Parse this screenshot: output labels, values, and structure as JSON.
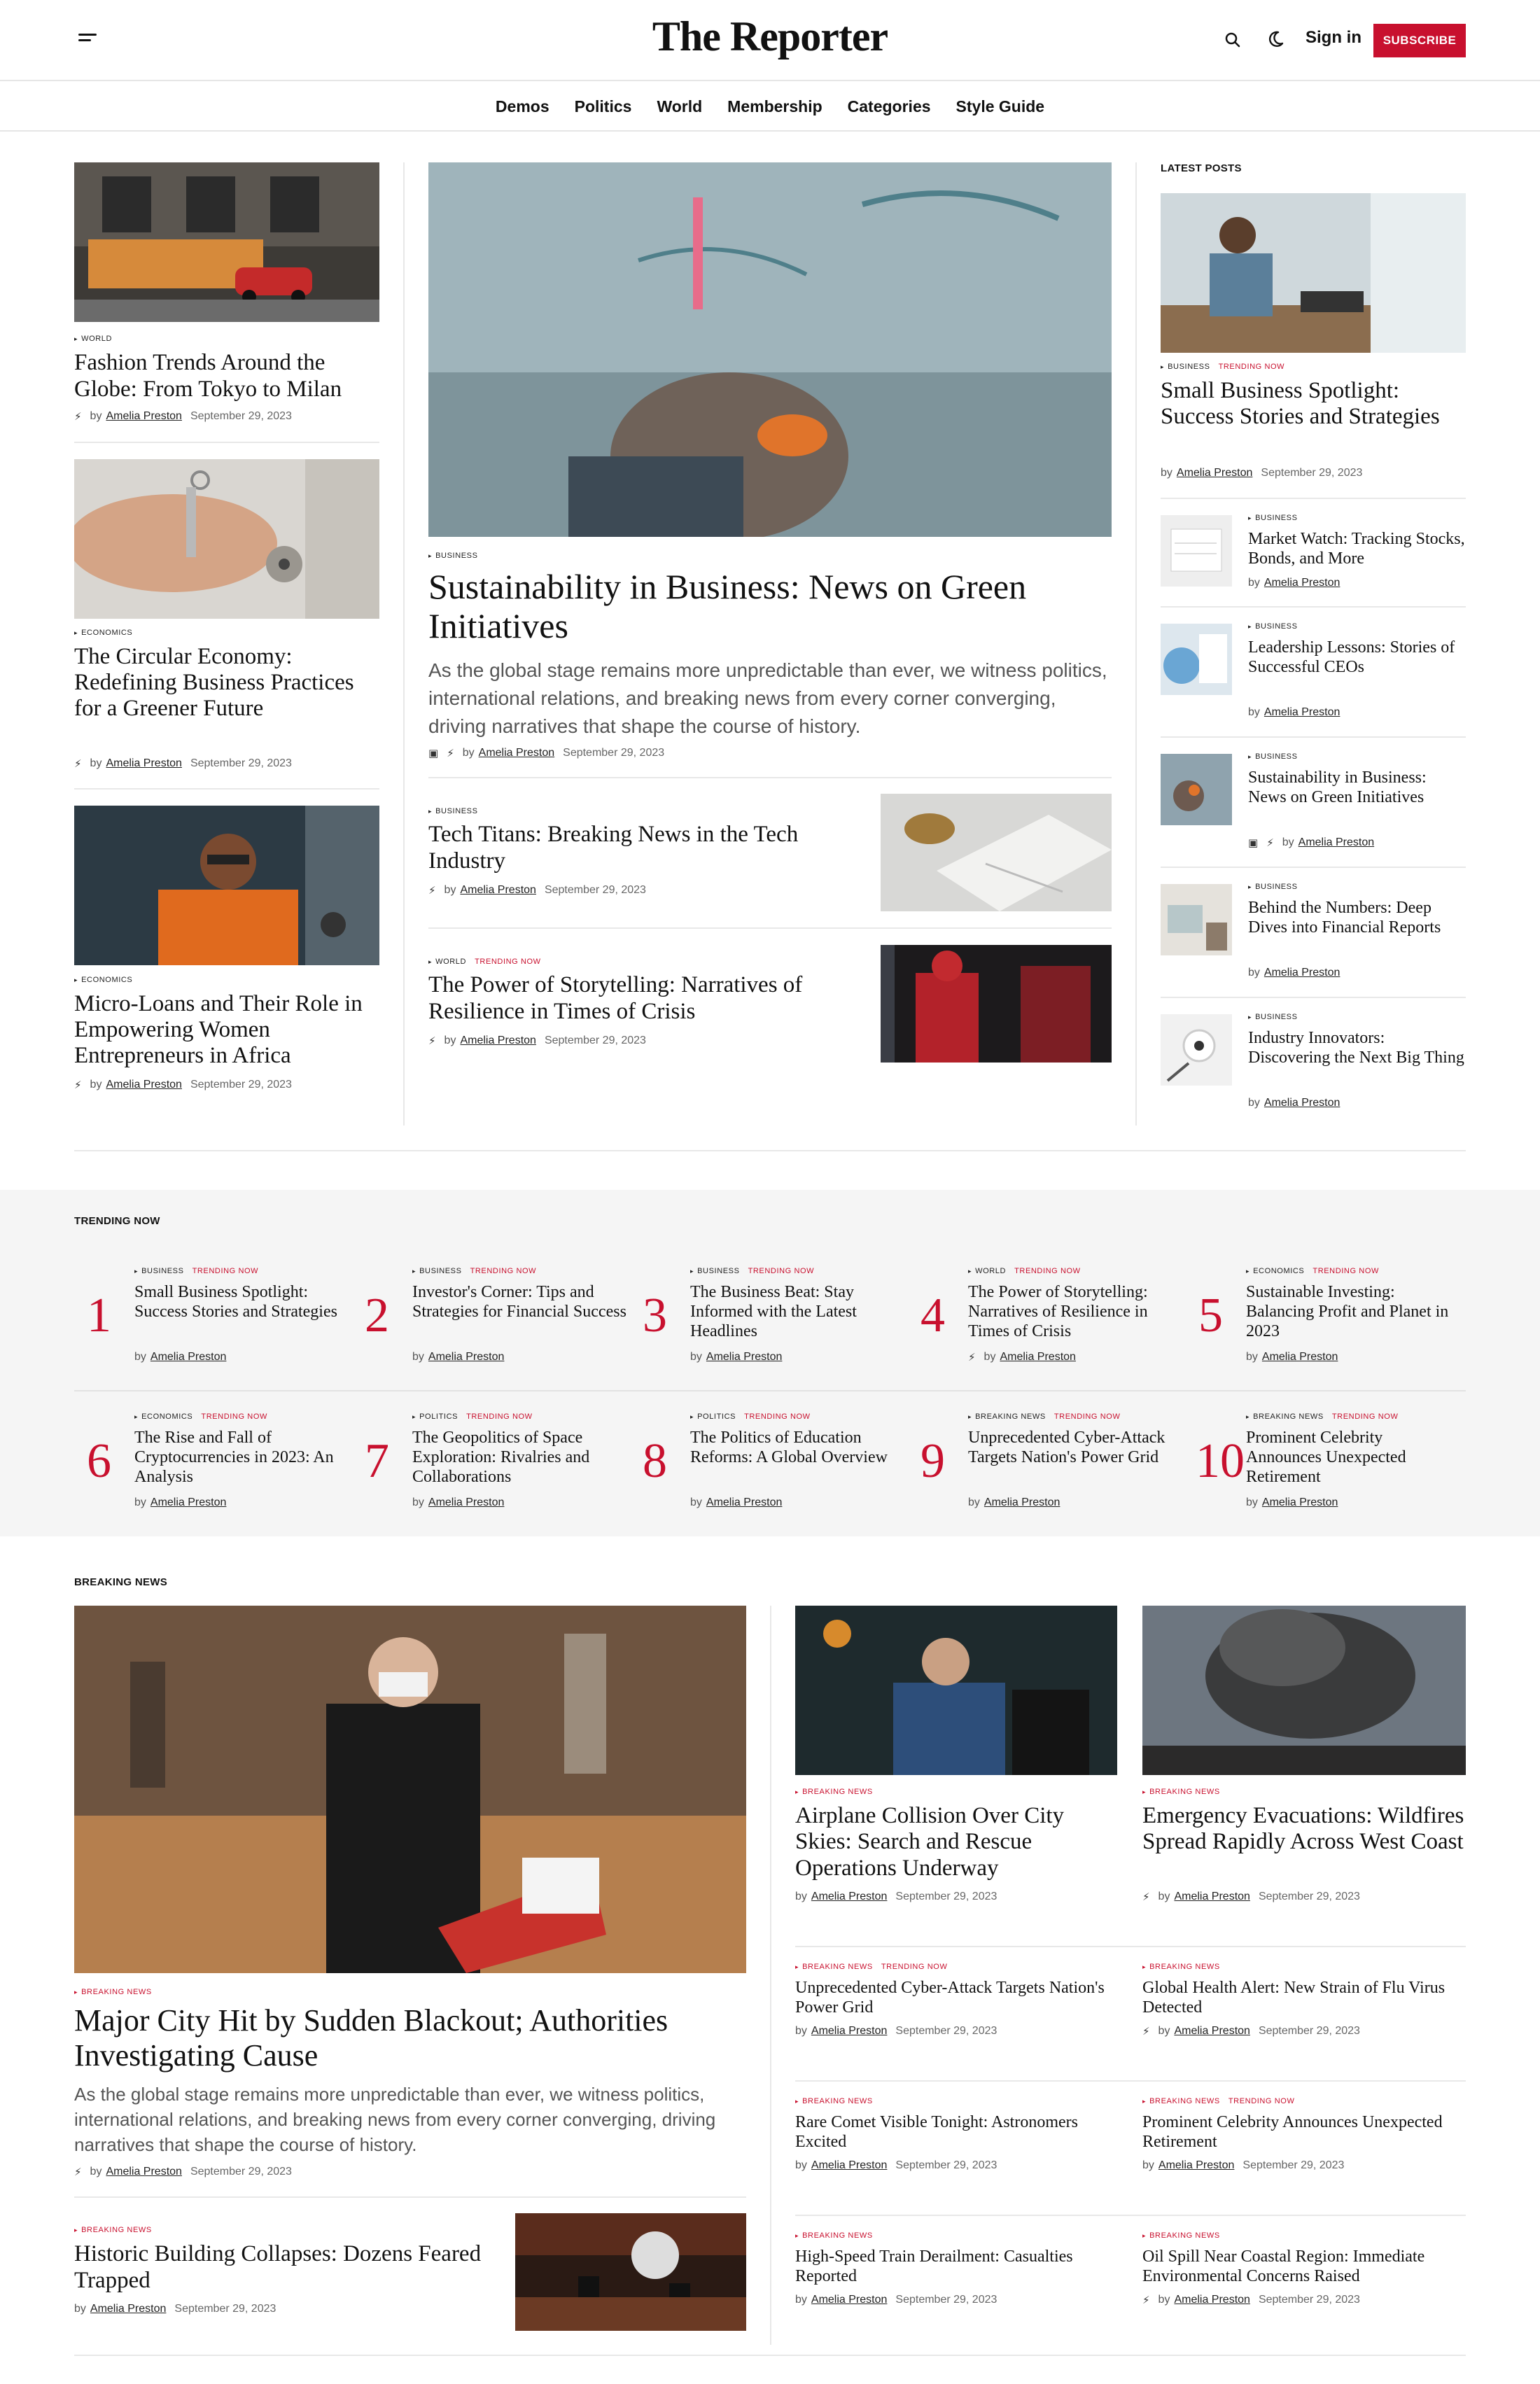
{
  "header": {
    "logo": "The Reporter",
    "sign_in": "Sign in",
    "subscribe": "SUBSCRIBE",
    "nav": [
      "Demos",
      "Politics",
      "World",
      "Membership",
      "Categories",
      "Style Guide"
    ]
  },
  "author": "Amelia Preston",
  "date": "September 29, 2023",
  "by": "by",
  "colors": {
    "accent": "#c8102e",
    "background": "#ffffff",
    "muted": "#f5f5f5"
  },
  "left": [
    {
      "cat": "WORLD",
      "title": "Fashion Trends Around the Globe: From Tokyo to Milan"
    },
    {
      "cat": "ECONOMICS",
      "title": "The Circular Economy: Redefining Business Practices for a Greener Future"
    },
    {
      "cat": "ECONOMICS",
      "title": "Micro-Loans and Their Role in Empowering Women Entrepreneurs in Africa"
    }
  ],
  "feature": {
    "cat": "BUSINESS",
    "title": "Sustainability in Business: News on Green Initiatives",
    "excerpt": "As the global stage remains more unpredictable than ever, we witness politics, international relations, and breaking news from every corner converging, driving narratives that shape the course of history."
  },
  "mid": [
    {
      "cat": "BUSINESS",
      "trend": "",
      "title": "Tech Titans: Breaking News in the Tech Industry"
    },
    {
      "cat": "WORLD",
      "trend": "TRENDING NOW",
      "title": "The Power of Storytelling: Narratives of Resilience in Times of Crisis"
    }
  ],
  "latest": {
    "label": "LATEST POSTS",
    "top": {
      "cat": "BUSINESS",
      "trend": "TRENDING NOW",
      "title": "Small Business Spotlight: Success Stories and Strategies"
    },
    "items": [
      {
        "cat": "BUSINESS",
        "title": "Market Watch: Tracking Stocks, Bonds, and More"
      },
      {
        "cat": "BUSINESS",
        "title": "Leadership Lessons: Stories of Successful CEOs"
      },
      {
        "cat": "BUSINESS",
        "title": "Sustainability in Business: News on Green Initiatives"
      },
      {
        "cat": "BUSINESS",
        "title": "Behind the Numbers: Deep Dives into Financial Reports"
      },
      {
        "cat": "BUSINESS",
        "title": "Industry Innovators: Discovering the Next Big Thing"
      }
    ]
  },
  "trending": {
    "label": "TRENDING NOW",
    "trend": "TRENDING NOW",
    "items": [
      {
        "n": "1",
        "cat": "BUSINESS",
        "title": "Small Business Spotlight: Success Stories and Strategies"
      },
      {
        "n": "2",
        "cat": "BUSINESS",
        "title": "Investor's Corner: Tips and Strategies for Financial Success"
      },
      {
        "n": "3",
        "cat": "BUSINESS",
        "title": "The Business Beat: Stay Informed with the Latest Headlines"
      },
      {
        "n": "4",
        "cat": "WORLD",
        "title": "The Power of Storytelling: Narratives of Resilience in Times of Crisis"
      },
      {
        "n": "5",
        "cat": "ECONOMICS",
        "title": "Sustainable Investing: Balancing Profit and Planet in 2023"
      },
      {
        "n": "6",
        "cat": "ECONOMICS",
        "title": "The Rise and Fall of Cryptocurrencies in 2023: An Analysis"
      },
      {
        "n": "7",
        "cat": "POLITICS",
        "title": "The Geopolitics of Space Exploration: Rivalries and Collaborations"
      },
      {
        "n": "8",
        "cat": "POLITICS",
        "title": "The Politics of Education Reforms: A Global Overview"
      },
      {
        "n": "9",
        "cat": "BREAKING NEWS",
        "title": "Unprecedented Cyber-Attack Targets Nation's Power Grid"
      },
      {
        "n": "10",
        "cat": "BREAKING NEWS",
        "title": "Prominent Celebrity Announces Unexpected Retirement"
      }
    ]
  },
  "breaking": {
    "label": "BREAKING NEWS",
    "main": {
      "cat": "BREAKING NEWS",
      "title": "Major City Hit by Sudden Blackout; Authorities Investigating Cause",
      "excerpt": "As the global stage remains more unpredictable than ever, we witness politics, international relations, and breaking news from every corner converging, driving narratives that shape the course of history."
    },
    "sub": {
      "cat": "BREAKING NEWS",
      "title": "Historic Building Collapses: Dozens Feared Trapped"
    },
    "cards": [
      {
        "cat": "BREAKING NEWS",
        "trend": "",
        "title": "Airplane Collision Over City Skies: Search and Rescue Operations Underway"
      },
      {
        "cat": "BREAKING NEWS",
        "trend": "",
        "title": "Emergency Evacuations: Wildfires Spread Rapidly Across West Coast"
      }
    ],
    "list": [
      {
        "cat": "BREAKING NEWS",
        "trend": "TRENDING NOW",
        "title": "Unprecedented Cyber-Attack Targets Nation's Power Grid"
      },
      {
        "cat": "BREAKING NEWS",
        "trend": "",
        "title": "Global Health Alert: New Strain of Flu Virus Detected"
      },
      {
        "cat": "BREAKING NEWS",
        "trend": "",
        "title": "Rare Comet Visible Tonight: Astronomers Excited"
      },
      {
        "cat": "BREAKING NEWS",
        "trend": "TRENDING NOW",
        "title": "Prominent Celebrity Announces Unexpected Retirement"
      },
      {
        "cat": "BREAKING NEWS",
        "trend": "",
        "title": "High-Speed Train Derailment: Casualties Reported"
      },
      {
        "cat": "BREAKING NEWS",
        "trend": "",
        "title": "Oil Spill Near Coastal Region: Immediate Environmental Concerns Raised"
      }
    ]
  }
}
